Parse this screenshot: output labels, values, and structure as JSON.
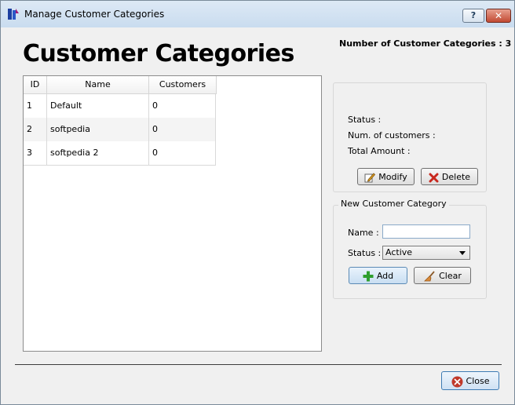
{
  "window": {
    "title": "Manage Customer Categories",
    "help_label": "?",
    "close_label": "✕"
  },
  "heading": "Customer Categories",
  "count_label": "Number of Customer Categories : 3",
  "table": {
    "columns": [
      "ID",
      "Name",
      "Customers"
    ],
    "rows": [
      {
        "id": "1",
        "name": "Default",
        "customers": "0"
      },
      {
        "id": "2",
        "name": "softpedia",
        "customers": "0"
      },
      {
        "id": "3",
        "name": "softpedia 2",
        "customers": "0"
      }
    ]
  },
  "details": {
    "status_label": "Status :",
    "num_customers_label": "Num. of customers :",
    "total_amount_label": "Total Amount :",
    "modify_label": "Modify",
    "delete_label": "Delete"
  },
  "new_category": {
    "title": "New Customer Category",
    "name_label": "Name :",
    "name_value": "",
    "status_label": "Status :",
    "status_value": "Active",
    "add_label": "Add",
    "clear_label": "Clear"
  },
  "close_label": "Close",
  "colors": {
    "delete_red": "#c8281e",
    "add_green": "#2e9e2e",
    "close_red": "#c0392b",
    "titlebar": "#d3e3f3"
  }
}
